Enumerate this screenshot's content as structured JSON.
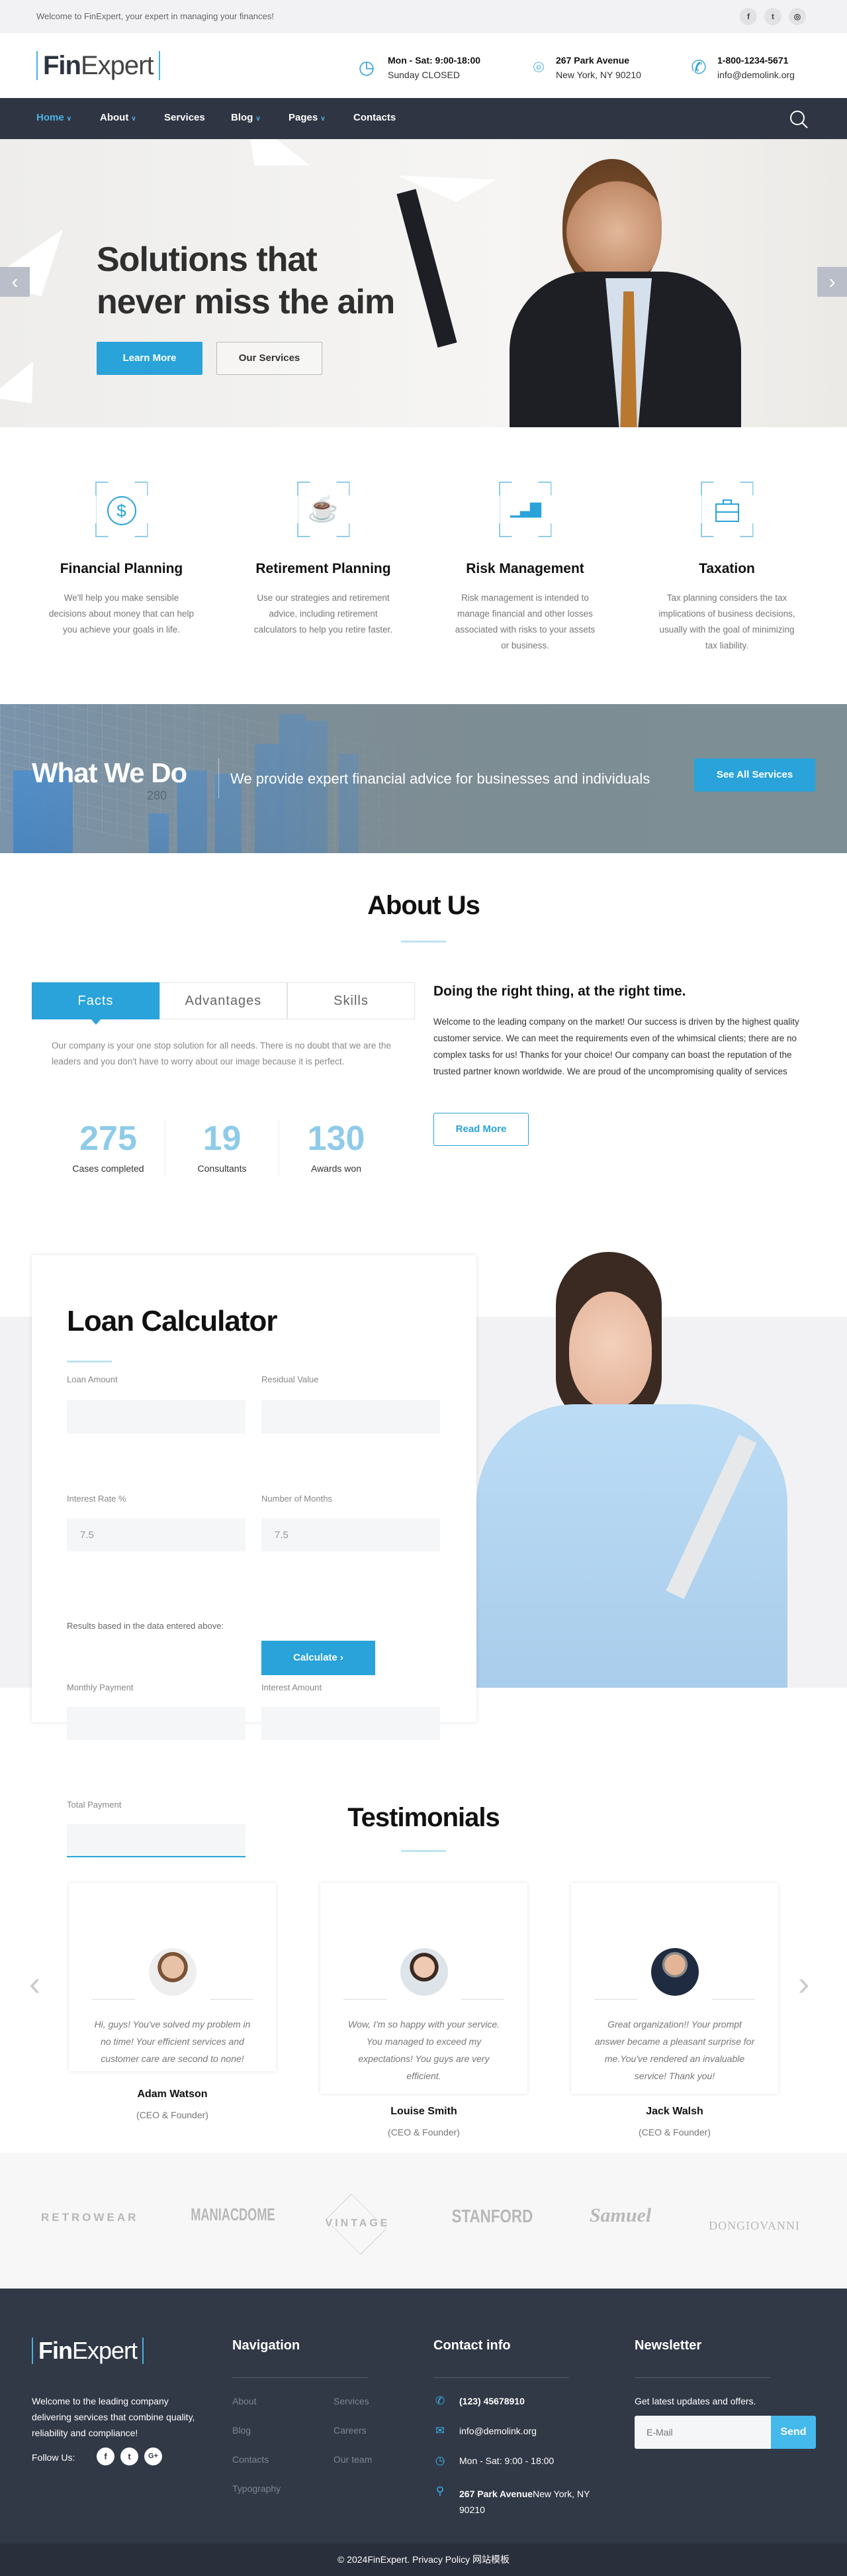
{
  "topbar": {
    "welcome": "Welcome to FinExpert, your expert in managing your finances!",
    "social": [
      {
        "icon": "facebook-icon",
        "glyph": "f"
      },
      {
        "icon": "twitter-icon",
        "glyph": "t"
      },
      {
        "icon": "instagram-icon",
        "glyph": "◎"
      }
    ]
  },
  "header": {
    "logo_bold": "Fin",
    "logo_light": "Expert",
    "hours": {
      "title": "Mon - Sat: 9:00-18:00",
      "sub": "Sunday CLOSED"
    },
    "address": {
      "title": "267 Park Avenue",
      "sub": "New York, NY 90210"
    },
    "phone": {
      "title": "1-800-1234-5671",
      "sub": "info@demolink.org"
    }
  },
  "nav": {
    "items": [
      {
        "label": "Home",
        "dropdown": true,
        "active": true
      },
      {
        "label": "About",
        "dropdown": true
      },
      {
        "label": "Services"
      },
      {
        "label": "Blog",
        "dropdown": true
      },
      {
        "label": "Pages",
        "dropdown": true
      },
      {
        "label": "Contacts"
      }
    ],
    "search_icon": "search-icon"
  },
  "hero": {
    "line1": "Solutions that",
    "line2": "never miss the aim",
    "primary": "Learn More",
    "secondary": "Our Services",
    "prev": "‹",
    "next": "›"
  },
  "services": [
    {
      "icon": "dollar-icon",
      "glyph": "$",
      "title": "Financial Planning",
      "text": "We'll help you make sensible decisions about money that can help you achieve your goals in life."
    },
    {
      "icon": "coffee-cup-icon",
      "glyph": "☕",
      "title": "Retirement Planning",
      "text": "Use our strategies and retirement advice, including retirement calculators to help you retire faster."
    },
    {
      "icon": "bar-chart-icon",
      "glyph": "▁▃▇",
      "title": "Risk Management",
      "text": "Risk management is intended to manage financial and other losses associated with risks to your assets or business."
    },
    {
      "icon": "briefcase-icon",
      "glyph": "💼",
      "title": "Taxation",
      "text": "Tax planning considers the tax implications of business decisions, usually with the goal of minimizing tax liability."
    }
  ],
  "whatwedo": {
    "title": "What We Do",
    "text": "We provide expert financial advice for businesses and individuals",
    "button": "See All Services",
    "bg_label": "280"
  },
  "about": {
    "title": "About Us",
    "tabs": [
      "Facts",
      "Advantages",
      "Skills"
    ],
    "active_tab": 0,
    "tab_text": "Our company is your one stop solution for all needs. There is no doubt that we are the leaders and you don't have to worry about our image because it is perfect.",
    "stats": [
      {
        "value": "275",
        "label": "Cases completed"
      },
      {
        "value": "19",
        "label": "Consultants"
      },
      {
        "value": "130",
        "label": "Awards won"
      }
    ],
    "heading": "Doing the right thing, at the right time.",
    "text": "Welcome to the leading company on the market! Our success is driven by the highest quality customer service. We can meet the requirements even of the whimsical clients; there are no complex tasks for us! Thanks for your choice! Our company can boast the reputation of the trusted partner known worldwide. We are proud of the uncompromising quality of services",
    "button": "Read More"
  },
  "loan": {
    "title": "Loan Calculator",
    "fields": {
      "loan_amount": {
        "label": "Loan Amount",
        "value": ""
      },
      "residual": {
        "label": "Residual Value",
        "value": ""
      },
      "rate": {
        "label": "Interest Rate %",
        "value": "7.5"
      },
      "months": {
        "label": "Number of Months",
        "value": "7.5"
      }
    },
    "results_note": "Results based in the data entered above:",
    "results": {
      "monthly": {
        "label": "Monthly Payment",
        "value": ""
      },
      "interest": {
        "label": "Interest Amount",
        "value": ""
      },
      "total": {
        "label": "Total Payment",
        "value": ""
      }
    },
    "button": "Calculate ›"
  },
  "testimonials": {
    "title": "Testimonials",
    "items": [
      {
        "quote": "Hi, guys! You've solved my problem in no time! Your efficient services and customer care are second to none!",
        "name": "Adam Watson",
        "role": "(CEO & Founder)"
      },
      {
        "quote": "Wow, I'm so happy with your service. You managed to exceed my expectations! You guys are very efficient.",
        "name": "Louise Smith",
        "role": "(CEO & Founder)"
      },
      {
        "quote": "Great organization!! Your prompt answer became a pleasant surprise for me.You've rendered an invaluable service! Thank you!",
        "name": "Jack Walsh",
        "role": "(CEO & Founder)"
      }
    ],
    "prev": "‹",
    "next": "›"
  },
  "partners": [
    "RETROWEAR",
    "MANIACDOME",
    "VINTAGE",
    "STANFORD",
    "Samuel",
    "DONGIOVANNI"
  ],
  "footer": {
    "about": "Welcome to the leading company delivering services that combine quality, reliability and compliance!",
    "follow": "Follow Us:",
    "social": [
      {
        "icon": "facebook-icon",
        "glyph": "f"
      },
      {
        "icon": "twitter-icon",
        "glyph": "t"
      },
      {
        "icon": "google-plus-icon",
        "glyph": "G+"
      }
    ],
    "nav_title": "Navigation",
    "nav_col1": [
      "About",
      "Blog",
      "Contacts",
      "Typography"
    ],
    "nav_col2": [
      "Services",
      "Careers",
      "Our team"
    ],
    "contact_title": "Contact info",
    "phone": "(123) 45678910",
    "email": "info@demolink.org",
    "hours": "Mon - Sat: 9:00 - 18:00",
    "address_bold": "267 Park Avenue",
    "address_rest": "New York, NY 90210",
    "newsletter_title": "Newsletter",
    "newsletter_text": "Get latest updates and offers.",
    "email_placeholder": "E-Mail",
    "send": "Send"
  },
  "copyright": "© 2024FinExpert. Privacy Policy 网站模板",
  "colors": {
    "accent": "#29a3d9",
    "nav_bg": "#2f3542",
    "footer_bg": "#313846"
  }
}
